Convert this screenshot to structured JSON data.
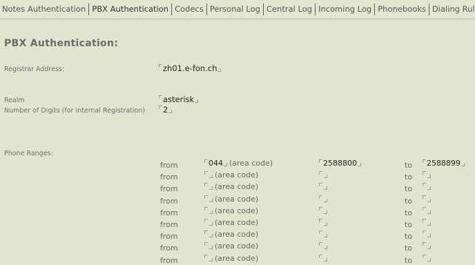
{
  "tabs": [
    {
      "label": "Notes Authentication",
      "active": false
    },
    {
      "label": "PBX Authentication",
      "active": true
    },
    {
      "label": "Codecs",
      "active": false
    },
    {
      "label": "Personal Log",
      "active": false
    },
    {
      "label": "Central Log",
      "active": false
    },
    {
      "label": "Incoming Log",
      "active": false
    },
    {
      "label": "Phonebooks",
      "active": false
    },
    {
      "label": "Dialing Rules",
      "active": false
    }
  ],
  "heading": "PBX Authentication:",
  "registrar": {
    "label": "Registrar Address:",
    "value": "zh01.e-fon.ch"
  },
  "realm": {
    "label": "Realm",
    "value": "asterisk"
  },
  "digits": {
    "label": "Number of Digits (for internal Registration)",
    "value": "2"
  },
  "phone_ranges": {
    "label": "Phone Ranges:",
    "from_word": "from",
    "to_word": "to",
    "area_hint": "(area code)",
    "rows": [
      {
        "area": "044",
        "from": "2588800",
        "to": "2588899"
      },
      {
        "area": "",
        "from": "",
        "to": ""
      },
      {
        "area": "",
        "from": "",
        "to": ""
      },
      {
        "area": "",
        "from": "",
        "to": ""
      },
      {
        "area": "",
        "from": "",
        "to": ""
      },
      {
        "area": "",
        "from": "",
        "to": ""
      },
      {
        "area": "",
        "from": "",
        "to": ""
      },
      {
        "area": "",
        "from": "",
        "to": ""
      },
      {
        "area": "",
        "from": "",
        "to": ""
      }
    ]
  }
}
